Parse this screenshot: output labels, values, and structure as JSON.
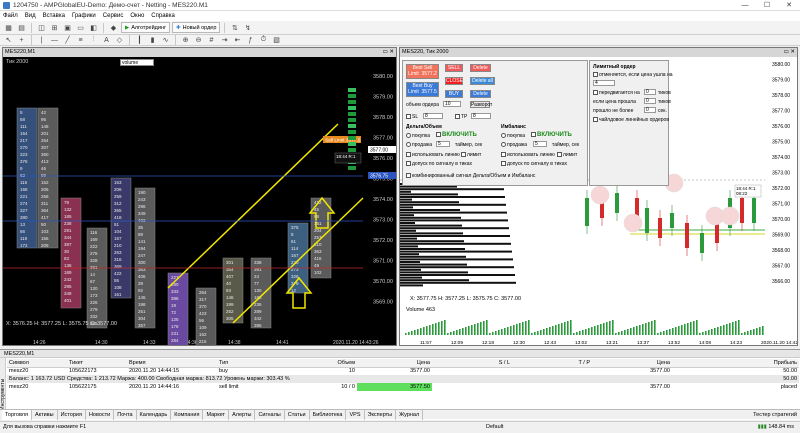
{
  "window": {
    "title": "1204750 - AMPGlobalEU-Demo: Демо-счет - Netting - MES220.M1",
    "buttons": [
      "—",
      "☐",
      "✕"
    ]
  },
  "menu": [
    "Файл",
    "Вид",
    "Вставка",
    "Графики",
    "Сервис",
    "Окно",
    "Справка"
  ],
  "toolbar": {
    "algo_label": "Алготрейдинг",
    "new_order_label": "Новый ордер"
  },
  "chart_left": {
    "tab_title": "MES220,M1",
    "header": "Тик  2000",
    "volume_dropdown": "volume",
    "status": "X: 3576.25  H: 3577.25  L: 3575.75  C: 3577.00",
    "price_labels": [
      "3580.00",
      "3579.00",
      "3578.00",
      "3577.00",
      "3576.00",
      "3575.00",
      "3574.00",
      "3573.00",
      "3572.00",
      "3571.00",
      "3570.00",
      "3569.00"
    ],
    "time_labels": [
      "14:26",
      "14:30",
      "14:33",
      "14:36",
      "14:38",
      "14:41",
      "2020.11.20 14:43:26"
    ],
    "sell_limit_tag": "Sell Limit  3577.5",
    "bid_tag": "3577.00",
    "ask_tag": "3576.75",
    "info_box": "18:44  R:1\n610"
  },
  "chart_right": {
    "header": "MES220, Тик  2000",
    "status": "X: 3577.75  H: 3577.25  L: 3575.75  C: 3577.00",
    "volume_label": "Volume 463",
    "price_labels": [
      "3580.00",
      "3579.00",
      "3578.00",
      "3577.00",
      "3576.00",
      "3575.00",
      "3574.00",
      "3573.00",
      "3572.00",
      "3571.00",
      "3570.00",
      "3569.00",
      "3568.00",
      "3567.00",
      "3566.00"
    ],
    "time_labels": [
      "11:57",
      "12:09",
      "12:18",
      "12:30",
      "12:43",
      "13:02",
      "13:21",
      "13:37",
      "13:52",
      "14:08",
      "14:23",
      "2020.11.20 14:42:00"
    ],
    "info_box": "18:44  R:1\n08:22"
  },
  "trade_panel": {
    "best_sell": "Best Sell\nLimit  3577.2",
    "best_buy": "Best Buy\nLimit  3577.5",
    "sell": "SELL",
    "delete": "Delete",
    "close": "CLOSE",
    "delete_all": "Delete all",
    "buy": "BUY",
    "delete2": "Delete",
    "volume_label": "объем ордера",
    "volume_value": "10",
    "sl_label": "SL",
    "sl_value": "8",
    "tp_label": "TP",
    "tp_value": "8",
    "razvod": "Разворот",
    "delta_title": "Дельта/Объем",
    "imbalance_title": "Имбаланс",
    "buy_opt": "покупка",
    "sell_opt": "продажа",
    "enable": "ВКЛЮЧИТЬ",
    "timer_label": "таймер, сек",
    "timer_value1": "5",
    "timer_value2": "5",
    "use_level": "использовать линию",
    "limit": "лимит",
    "allow_ticks": "допуск по сигналу в тиках",
    "combined": "комбинированный сигнал Дельта/Объем и Имбаланс",
    "trailing_title": "Лимитный ордер",
    "trailing_1": "отменяется, если цена ушла на",
    "trailing_value": "4",
    "trailing_2": "передвигается на",
    "trailing_2_value": "0",
    "ticks": "тиков",
    "trailing_3": "если цена прошла",
    "trailing_3_value": "0",
    "trailing_4": "прошло не более",
    "trailing_4_value": "0",
    "sec": "сек.",
    "trail_levels": "чайлдовое линейных ордеров"
  },
  "bottom_panel": {
    "top_tab": "MES220,M1",
    "side_label": "Инструменты",
    "columns": [
      "Символ",
      "Тикет",
      "Время",
      "Тип",
      "Объем",
      "Цена",
      "S / L",
      "T / P",
      "Цена",
      "Прибыль"
    ],
    "rows": [
      {
        "symbol": "mesz20",
        "ticket": "105622173",
        "time": "2020.11.20 14:44:15",
        "type": "buy",
        "volume": "10",
        "price": "3577.00",
        "sl": "",
        "tp": "",
        "cur": "3577.00",
        "profit": "50.00"
      },
      {
        "symbol": "mesz20",
        "ticket": "105622175",
        "time": "2020.11.20 14:44:16",
        "type": "sell limit",
        "volume": "10 / 0",
        "price": "3577.50",
        "sl": "",
        "tp": "",
        "cur": "3577.00",
        "profit": "placed"
      }
    ],
    "balance_line": "Баланс: 1 163.72 USD  Средства: 1 213.72  Маржа: 400.00  Свободная маржа: 813.72  Уровень маржи: 303.43 %",
    "balance_profit": "50.00"
  },
  "tabs": [
    "Торговля",
    "Активы",
    "История",
    "Новости",
    "Почта",
    "Календарь",
    "Компания",
    "Маркет",
    "Алерты",
    "Сигналы",
    "Статьи",
    "Библиотека",
    "VPS",
    "Эксперты",
    "Журнал"
  ],
  "tab_right": "Тестер стратегий",
  "status": {
    "left": "Для вызова справки нажмите F1",
    "mid": "Default",
    "right": "148.84 ms"
  }
}
